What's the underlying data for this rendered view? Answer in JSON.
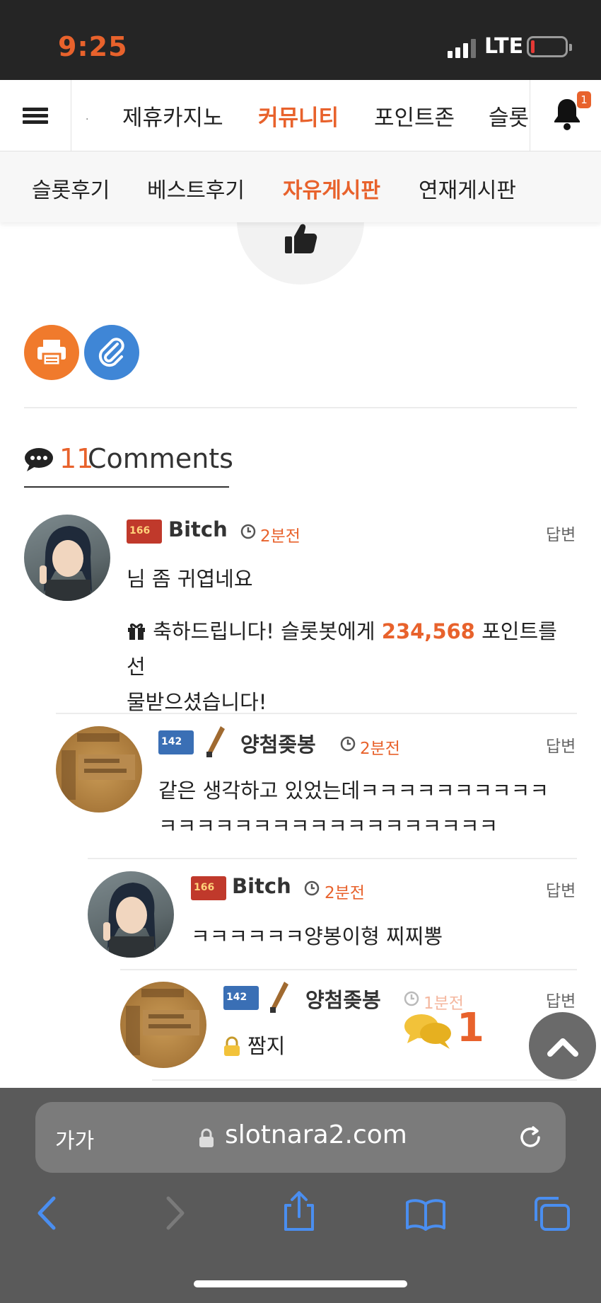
{
  "status_bar": {
    "time": "9:25",
    "network": "LTE"
  },
  "top_nav": {
    "tabs": [
      "제휴카지노",
      "커뮤니티",
      "포인트존",
      "슬롯"
    ],
    "active_tab": "커뮤니티",
    "notification_count": "1"
  },
  "sub_nav": {
    "items": [
      "슬롯후기",
      "베스트후기",
      "자유게시판",
      "연재게시판"
    ],
    "active": "자유게시판"
  },
  "comments": {
    "count": "11",
    "label": "Comments",
    "items": [
      {
        "level": "166",
        "nick": "Bitch",
        "time": "2분전",
        "reply": "답변",
        "text": "님 좀 귀엽네요",
        "gift_prefix": "축하드립니다! 슬롯봇에게 ",
        "gift_points": "234,568",
        "gift_line1_suffix": " 포인트를 선",
        "gift_line2": "물받으셨습니다!"
      },
      {
        "level": "142",
        "nick": "양첨좆봉",
        "time": "2분전",
        "reply": "답변",
        "text_line1": "같은 생각하고 있었는데ㅋㅋㅋㅋㅋㅋㅋㅋㅋㅋ",
        "text_line2": "ㅋㅋㅋㅋㅋㅋㅋㅋㅋㅋㅋㅋㅋㅋㅋㅋㅋㅋ"
      },
      {
        "level": "166",
        "nick": "Bitch",
        "time": "2분전",
        "reply": "답변",
        "text": "ㅋㅋㅋㅋㅋㅋ양봉이형 찌찌뽕"
      },
      {
        "level": "142",
        "nick": "양첨좆봉",
        "time": "1분전",
        "reply": "답변",
        "text": "짬지",
        "chat_count": "1"
      }
    ]
  },
  "browser": {
    "text_size": "가가",
    "domain": "slotnara2.com"
  },
  "colors": {
    "accent": "#e8622c",
    "print_button": "#f07a2c",
    "link_button": "#3f86d6",
    "level_red": "#c0392b",
    "level_blue": "#3a6fb5"
  }
}
